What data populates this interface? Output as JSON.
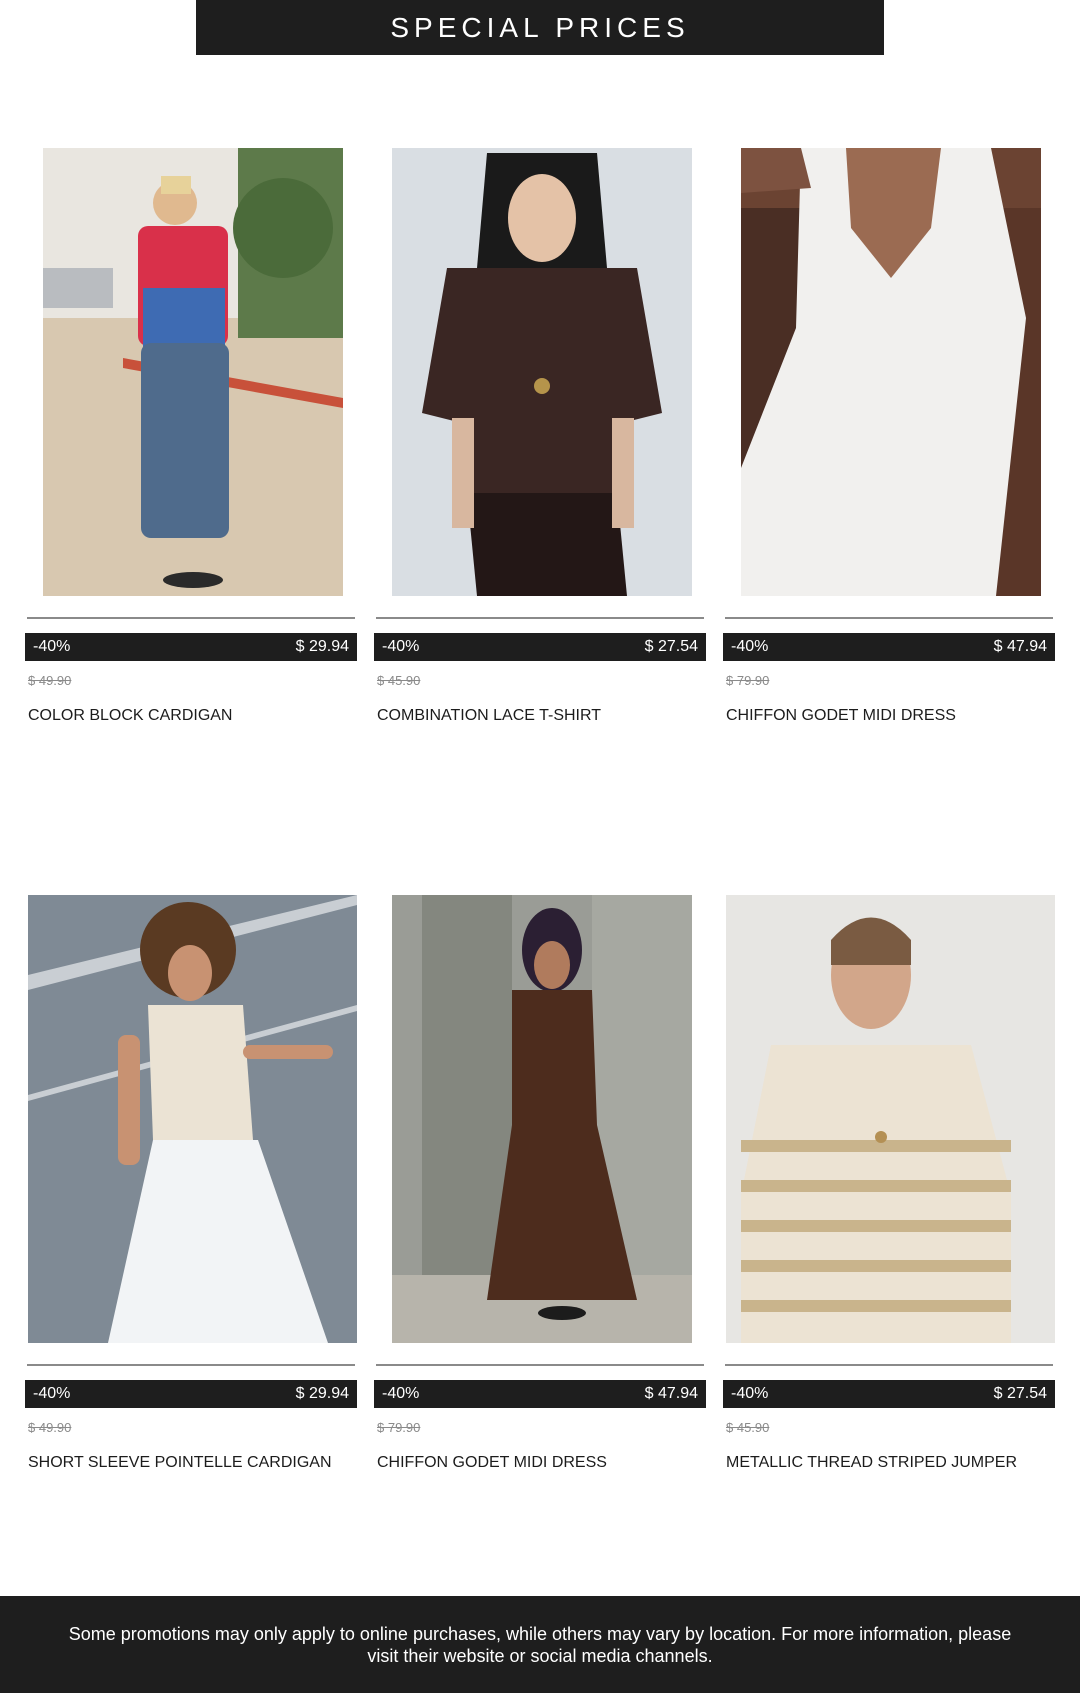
{
  "header": {
    "title": "SPECIAL PRICES"
  },
  "products": [
    {
      "discount": "-40%",
      "price": "$ 29.94",
      "old_price": "$ 49.90",
      "name": "COLOR BLOCK CARDIGAN",
      "image": "photo-model-red-blue-cardigan-jeans"
    },
    {
      "discount": "-40%",
      "price": "$ 27.54",
      "old_price": "$ 45.90",
      "name": "COMBINATION LACE T-SHIRT",
      "image": "photo-model-brown-lace-tshirt"
    },
    {
      "discount": "-40%",
      "price": "$ 47.94",
      "old_price": "$ 79.90",
      "name": "CHIFFON GODET MIDI DRESS",
      "image": "photo-white-chiffon-dress"
    },
    {
      "discount": "-40%",
      "price": "$ 29.94",
      "old_price": "$ 49.90",
      "name": "SHORT SLEEVE POINTELLE CARDIGAN",
      "image": "photo-model-pointelle-cardigan-white-trousers"
    },
    {
      "discount": "-40%",
      "price": "$ 47.94",
      "old_price": "$ 79.90",
      "name": "CHIFFON GODET MIDI DRESS",
      "image": "photo-model-brown-midi-dress"
    },
    {
      "discount": "-40%",
      "price": "$ 27.54",
      "old_price": "$ 45.90",
      "name": "METALLIC THREAD STRIPED JUMPER",
      "image": "photo-model-striped-jumper"
    }
  ],
  "footer": {
    "text": "Some promotions may only apply to online purchases, while others may vary by location. For more information, please visit their website or social media channels."
  },
  "colors": {
    "banner": "#1e1e1e",
    "price_bar": "#1e1e1e",
    "old_price": "#8a8a8a"
  }
}
